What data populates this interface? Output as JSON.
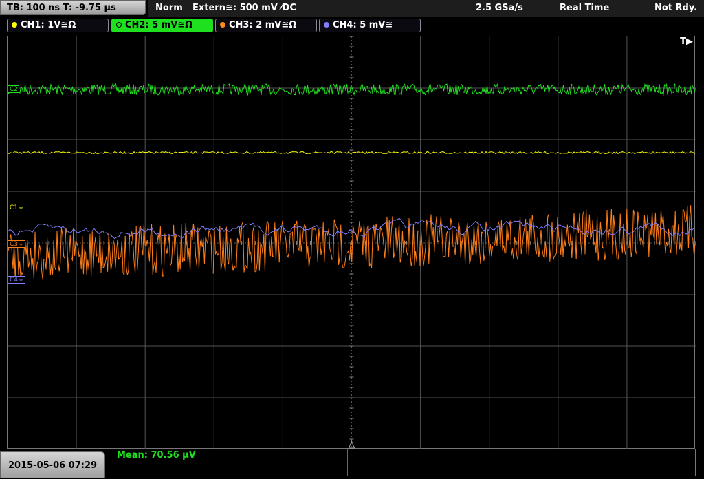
{
  "header": {
    "timebase": "TB: 100 ns   T: -9.75 µs",
    "trigger_mode": "Norm",
    "trigger_source": "Extern≅: 500 mV ⁄DC",
    "sample_rate": "2.5 GSa/s",
    "acq_mode": "Real Time",
    "status": "Not Rdy."
  },
  "channels": [
    {
      "label": "CH1: 1V≅Ω",
      "color": "#ffff00"
    },
    {
      "label": "CH2: 5 mV≅Ω",
      "color": "#1fe01f"
    },
    {
      "label": "CH3: 2 mV≅Ω",
      "color": "#ff8c1a"
    },
    {
      "label": "CH4: 5 mV≅",
      "color": "#8080ff"
    }
  ],
  "markers": {
    "c1": "C1⏚",
    "c2": "C2",
    "c3": "C3⏚",
    "c4": "C4⏚"
  },
  "trigger_label": "T▶",
  "footer": {
    "datetime": "2015-05-06 07:29",
    "measurement": "Mean: 70.56 µV"
  },
  "colors": {
    "ch1": "#ffff00",
    "ch2": "#22e022",
    "ch3": "#ff7f1a",
    "ch4": "#7f7fff",
    "grid": "#555555"
  }
}
